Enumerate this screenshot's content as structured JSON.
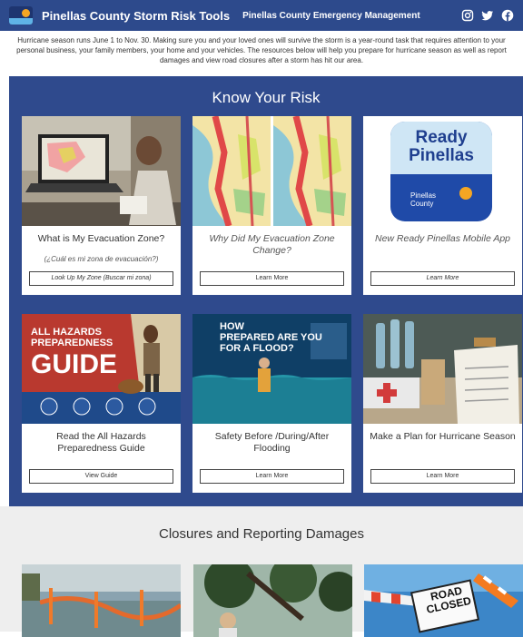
{
  "header": {
    "app_title": "Pinellas County Storm Risk Tools",
    "org_link": "Pinellas County Emergency Management",
    "logo_text": "Pinellas County",
    "social": [
      "instagram-icon",
      "twitter-icon",
      "facebook-icon"
    ]
  },
  "intro": {
    "text": "Hurricane season runs June 1 to Nov. 30. Making sure you and your loved ones will survive the storm is a year-round task that requires attention to your personal business, your family members, your home and your vehicles. The resources below will help you prepare for hurricane season as well as report damages and view road closures after a storm has hit our area."
  },
  "risk": {
    "title": "Know Your Risk",
    "cards": [
      {
        "title": "What is My Evacuation Zone?",
        "subtitle": "(¿Cuál es mi zona de evacuación?)",
        "button": "Look Up My Zone (Buscar mi zona)"
      },
      {
        "title": "Why Did My Evacuation Zone Change?",
        "button": "Learn More"
      },
      {
        "title": "New Ready Pinellas Mobile App",
        "button": "Learn More",
        "image_text": {
          "line1": "Ready",
          "line2": "Pinellas",
          "badge": "Pinellas County"
        }
      },
      {
        "title": "Read the All Hazards Preparedness Guide",
        "button": "View Guide",
        "image_text": {
          "line1": "ALL HAZARDS",
          "line2": "PREPAREDNESS",
          "line3": "GUIDE"
        }
      },
      {
        "title": "Safety Before /During/After Flooding",
        "button": "Learn More",
        "image_text": {
          "line1": "HOW",
          "line2": "PREPARED ARE YOU",
          "line3": "FOR A FLOOD?"
        }
      },
      {
        "title": "Make a Plan for Hurricane Season",
        "button": "Learn More"
      }
    ]
  },
  "closures": {
    "title": "Closures and Reporting Damages",
    "road_sign": {
      "line1": "ROAD",
      "line2": "CLOSED"
    }
  },
  "colors": {
    "header_bg": "#2d4a8c",
    "risk_bg": "#2f4a8d",
    "closures_bg": "#eeeeee"
  }
}
